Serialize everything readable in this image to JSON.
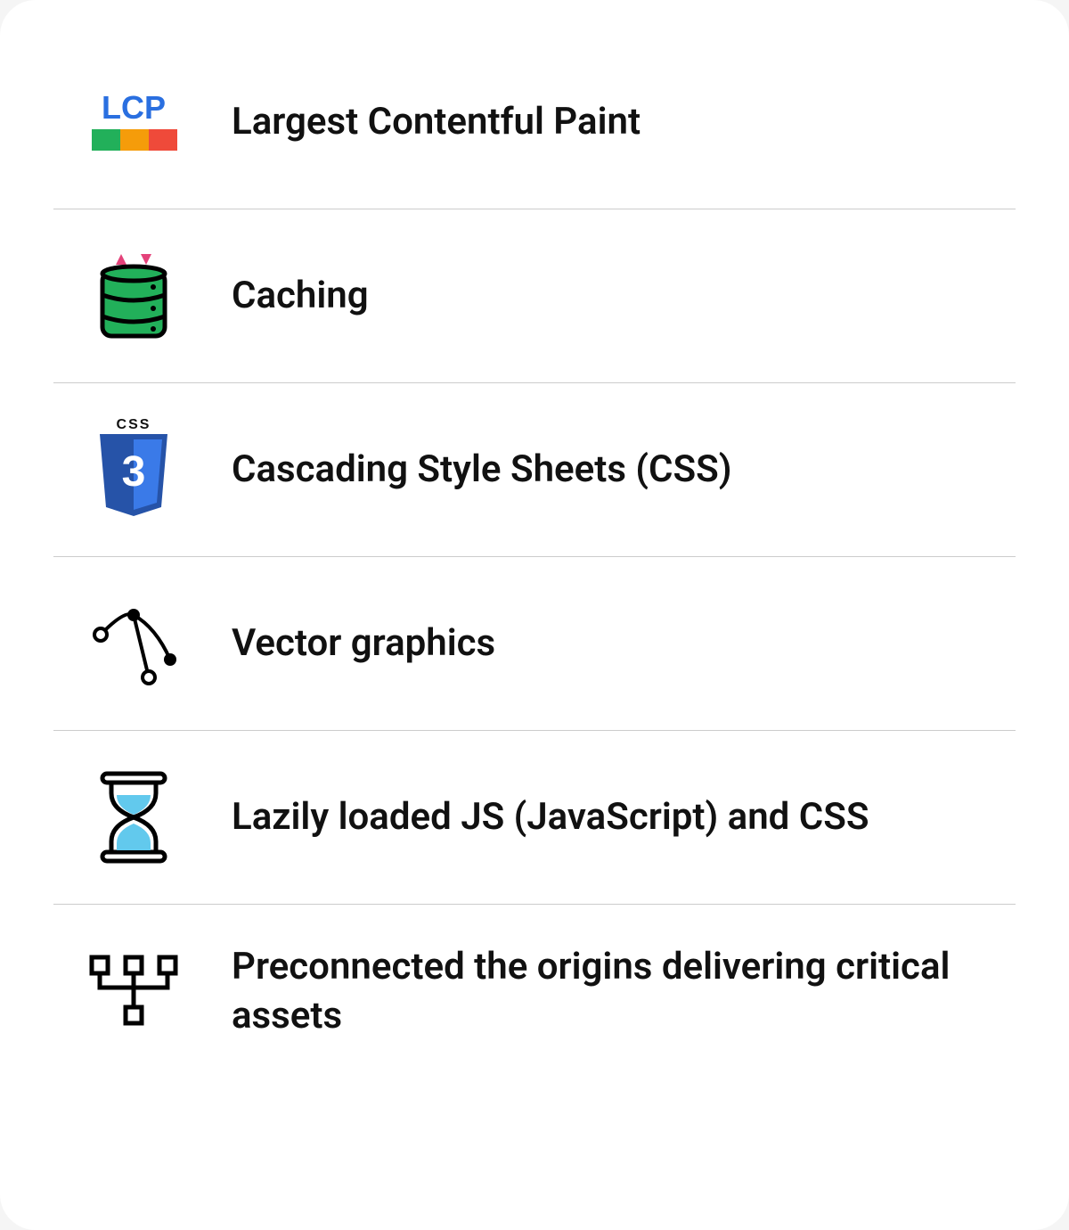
{
  "items": [
    {
      "icon": "lcp-icon",
      "label": "Largest Contentful Paint"
    },
    {
      "icon": "caching-icon",
      "label": "Caching"
    },
    {
      "icon": "css-icon",
      "label": "Cascading Style Sheets (CSS)"
    },
    {
      "icon": "vector-icon",
      "label": "Vector graphics"
    },
    {
      "icon": "hourglass-icon",
      "label": "Lazily loaded JS (JavaScript) and CSS"
    },
    {
      "icon": "preconnect-icon",
      "label": "Preconnected the origins delivering critical assets"
    }
  ],
  "lcp_text": "LCP",
  "css_badge": "CSS",
  "css_num": "3",
  "colors": {
    "green": "#22b05a",
    "orange": "#f59c0a",
    "red": "#ef4a3a",
    "blue": "#2a6fe0",
    "css_blue": "#2965f1",
    "pink": "#e4427a",
    "cyan": "#62c9ed"
  }
}
